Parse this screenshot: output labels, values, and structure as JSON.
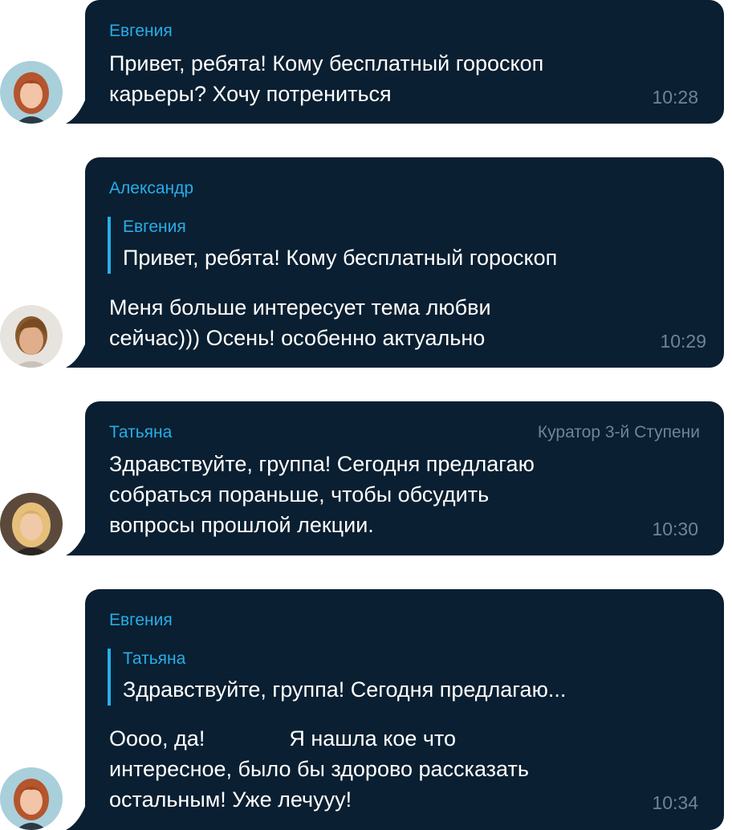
{
  "messages": [
    {
      "sender": "Евгения",
      "text": "Привет, ребята! Кому бесплатный гороскоп\nкарьеры? Хочу потрениться",
      "time": "10:28",
      "avatar": "woman-redhead-avatar"
    },
    {
      "sender": "Александр",
      "reply": {
        "sender": "Евгения",
        "text": "Привет, ребята! Кому бесплатный гороскоп"
      },
      "text": "Меня больше интересует тема любви\nсейчас))) Осень! особенно актуально",
      "time": "10:29",
      "avatar": "young-man-avatar"
    },
    {
      "sender": "Татьяна",
      "role": "Куратор 3-й Ступени",
      "text": "Здравствуйте, группа! Сегодня предлагаю\nсобраться пораньше, чтобы обсудить\nвопросы прошлой лекции.",
      "time": "10:30",
      "avatar": "woman-blonde-avatar"
    },
    {
      "sender": "Евгения",
      "reply": {
        "sender": "Татьяна",
        "text": "Здравствуйте, группа! Сегодня предлагаю..."
      },
      "text": "Оооо, да!              Я нашла кое что\nинтересное, было бы здорово рассказать\nостальным! Уже лечууу!",
      "time": "10:34",
      "avatar": "woman-redhead-avatar"
    }
  ],
  "colors": {
    "bubble": "#0a1f31",
    "accent": "#27aee8",
    "muted": "#6d8596",
    "text": "#ffffff"
  }
}
